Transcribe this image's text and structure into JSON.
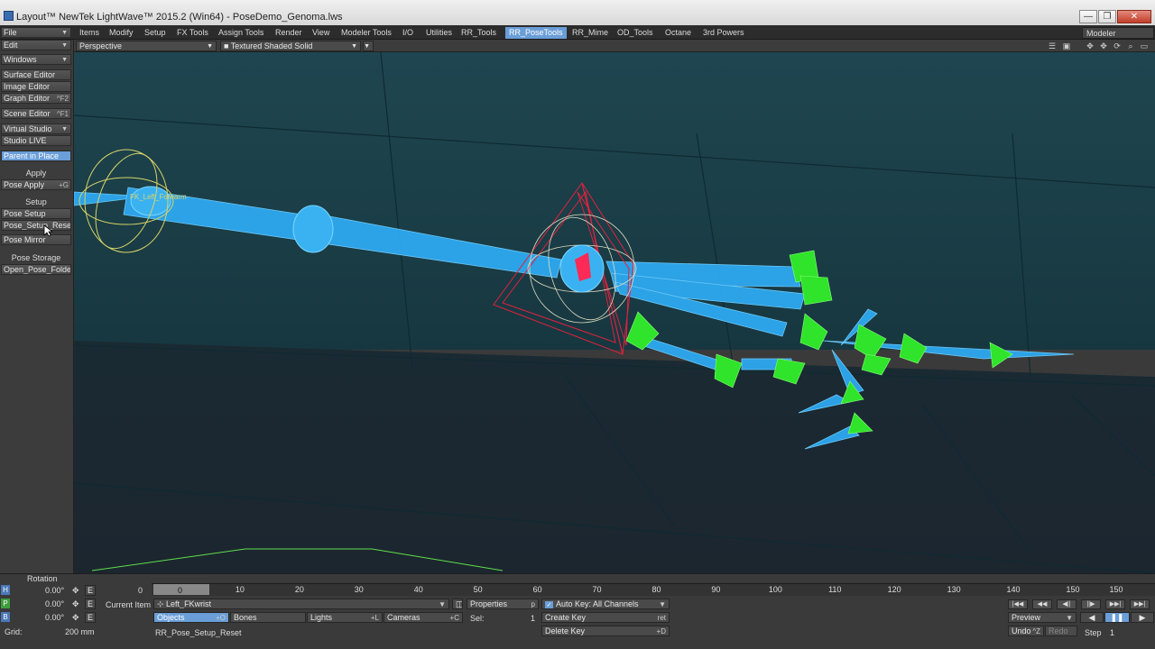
{
  "window": {
    "title": "Layout™ NewTek LightWave™ 2015.2 (Win64) - PoseDemo_Genoma.lws",
    "min": "—",
    "max": "❐",
    "close": "✕"
  },
  "menu_tabs": [
    "Items",
    "Modify",
    "Setup",
    "FX Tools",
    "Assign Tools",
    "Render",
    "View",
    "Modeler Tools",
    "I/O",
    "Utilities",
    "RR_Tools",
    "RR_PoseTools",
    "RR_Mime",
    "OD_Tools",
    "Octane",
    "3rd Powers"
  ],
  "active_tab": "RR_PoseTools",
  "modeler_label": "Modeler",
  "left": {
    "file": "File",
    "edit": "Edit",
    "windows": "Windows",
    "surface_editor": "Surface Editor",
    "image_editor": "Image Editor",
    "graph_editor": "Graph Editor",
    "graph_editor_sc": "^F2",
    "scene_editor": "Scene Editor",
    "scene_editor_sc": "^F1",
    "virtual_studio": "Virtual Studio",
    "studio_live": "Studio LIVE",
    "parent_in_place": "Parent in Place",
    "apply_header": "Apply",
    "pose_apply": "Pose Apply",
    "pose_apply_sc": "+G",
    "setup_header": "Setup",
    "pose_setup": "Pose Setup",
    "pose_setup_reset": "Pose_Setup_Reset",
    "pose_mirror": "Pose Mirror",
    "pose_storage_header": "Pose Storage",
    "open_pose_folder": "Open_Pose_Folder"
  },
  "viewport": {
    "view_mode": "Perspective",
    "render_mode": "Textured Shaded Solid",
    "bone_label": "FK_Left_Forearm"
  },
  "bottom": {
    "rotation_label": "Rotation",
    "h": {
      "label": "H",
      "value": "0.00°"
    },
    "p": {
      "label": "P",
      "value": "0.00°"
    },
    "b": {
      "label": "B",
      "value": "0.00°"
    },
    "env_label": "E",
    "grid_label": "Grid:",
    "grid_value": "200 mm",
    "timeline_ticks": [
      "0",
      "10",
      "20",
      "30",
      "40",
      "50",
      "60",
      "70",
      "80",
      "90",
      "100",
      "110",
      "120",
      "130",
      "140",
      "150"
    ],
    "timeline_start": "0",
    "timeline_end": "150",
    "current_frame": "0",
    "current_item_label": "Current Item",
    "current_item": "Left_FKwrist",
    "objects": "Objects",
    "objects_sc": "+O",
    "bones": "Bones",
    "lights": "Lights",
    "lights_sc": "+L",
    "cameras": "Cameras",
    "cameras_sc": "+C",
    "status": "RR_Pose_Setup_Reset",
    "properties": "Properties",
    "properties_sc": "p",
    "sel_label": "Sel:",
    "sel_value": "1",
    "auto_key": "Auto Key: All Channels",
    "create_key": "Create Key",
    "create_key_sc": "ret",
    "delete_key": "Delete Key",
    "delete_key_sc": "+D",
    "transport": [
      "|◀◀",
      "◀◀",
      "◀||",
      "||▶",
      "▶▶|",
      "▶▶|"
    ],
    "preview": "Preview",
    "undo": "Undo",
    "undo_sc": "^Z",
    "redo": "Redo",
    "step_label": "Step",
    "step_value": "1"
  }
}
